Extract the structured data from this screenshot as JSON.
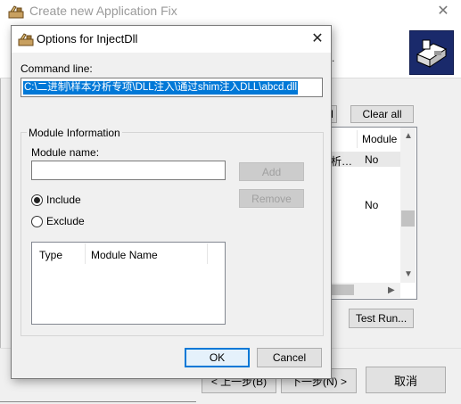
{
  "background_window": {
    "title": "Create new Application Fix",
    "header_fragment": ".",
    "clear_all_button": "Clear all",
    "list": {
      "column_header": "Module",
      "row1_col1": "析…",
      "row1_col2": "No",
      "row2_col2": "No"
    },
    "test_run_button": "Test Run...",
    "back_button": "< 上一步(B)",
    "next_button": "下一步(N) >",
    "cancel_button": "取消"
  },
  "dialog": {
    "title": "Options for InjectDll",
    "command_line_label": "Command line:",
    "command_line_value": "C:\\二进制\\样本分析专项\\DLL注入\\通过shim注入DLL\\abcd.dll",
    "module_info_group": "Module Information",
    "module_name_label": "Module name:",
    "module_name_value": "",
    "add_button": "Add",
    "remove_button": "Remove",
    "include_label": "Include",
    "exclude_label": "Exclude",
    "include_selected": true,
    "list_columns": [
      "Type",
      "Module Name"
    ],
    "ok_button": "OK",
    "cancel_button": "Cancel"
  },
  "colors": {
    "selection": "#0078d7",
    "default_button_border": "#0078d7",
    "logo_bg": "#1a2a6b"
  }
}
